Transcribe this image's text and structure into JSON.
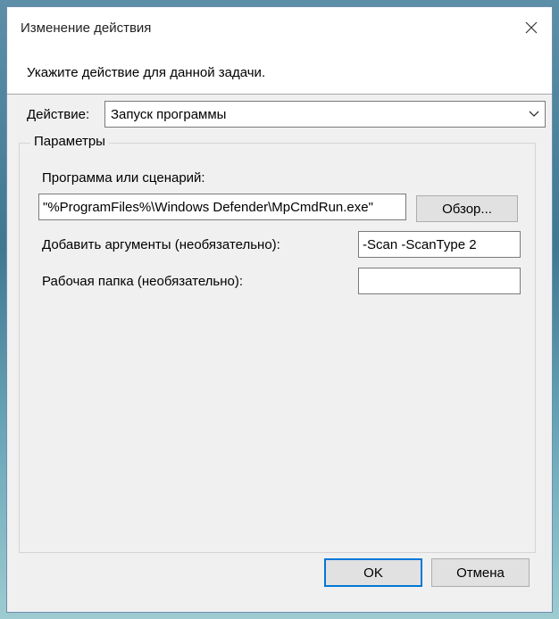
{
  "dialog": {
    "title": "Изменение действия",
    "instruction": "Укажите действие для данной задачи."
  },
  "action": {
    "label": "Действие:",
    "selected": "Запуск программы"
  },
  "parameters": {
    "group_title": "Параметры",
    "program_label": "Программа или сценарий:",
    "program_value": "\"%ProgramFiles%\\Windows Defender\\MpCmdRun.exe\"",
    "browse_label": "Обзор...",
    "arguments_label": "Добавить аргументы (необязательно):",
    "arguments_value": "-Scan -ScanType 2",
    "workdir_label": "Рабочая папка (необязательно):",
    "workdir_value": ""
  },
  "buttons": {
    "ok_label": "OK",
    "cancel_label": "Отмена"
  },
  "icons": {
    "close": "close-icon",
    "dropdown": "chevron-down-icon"
  }
}
